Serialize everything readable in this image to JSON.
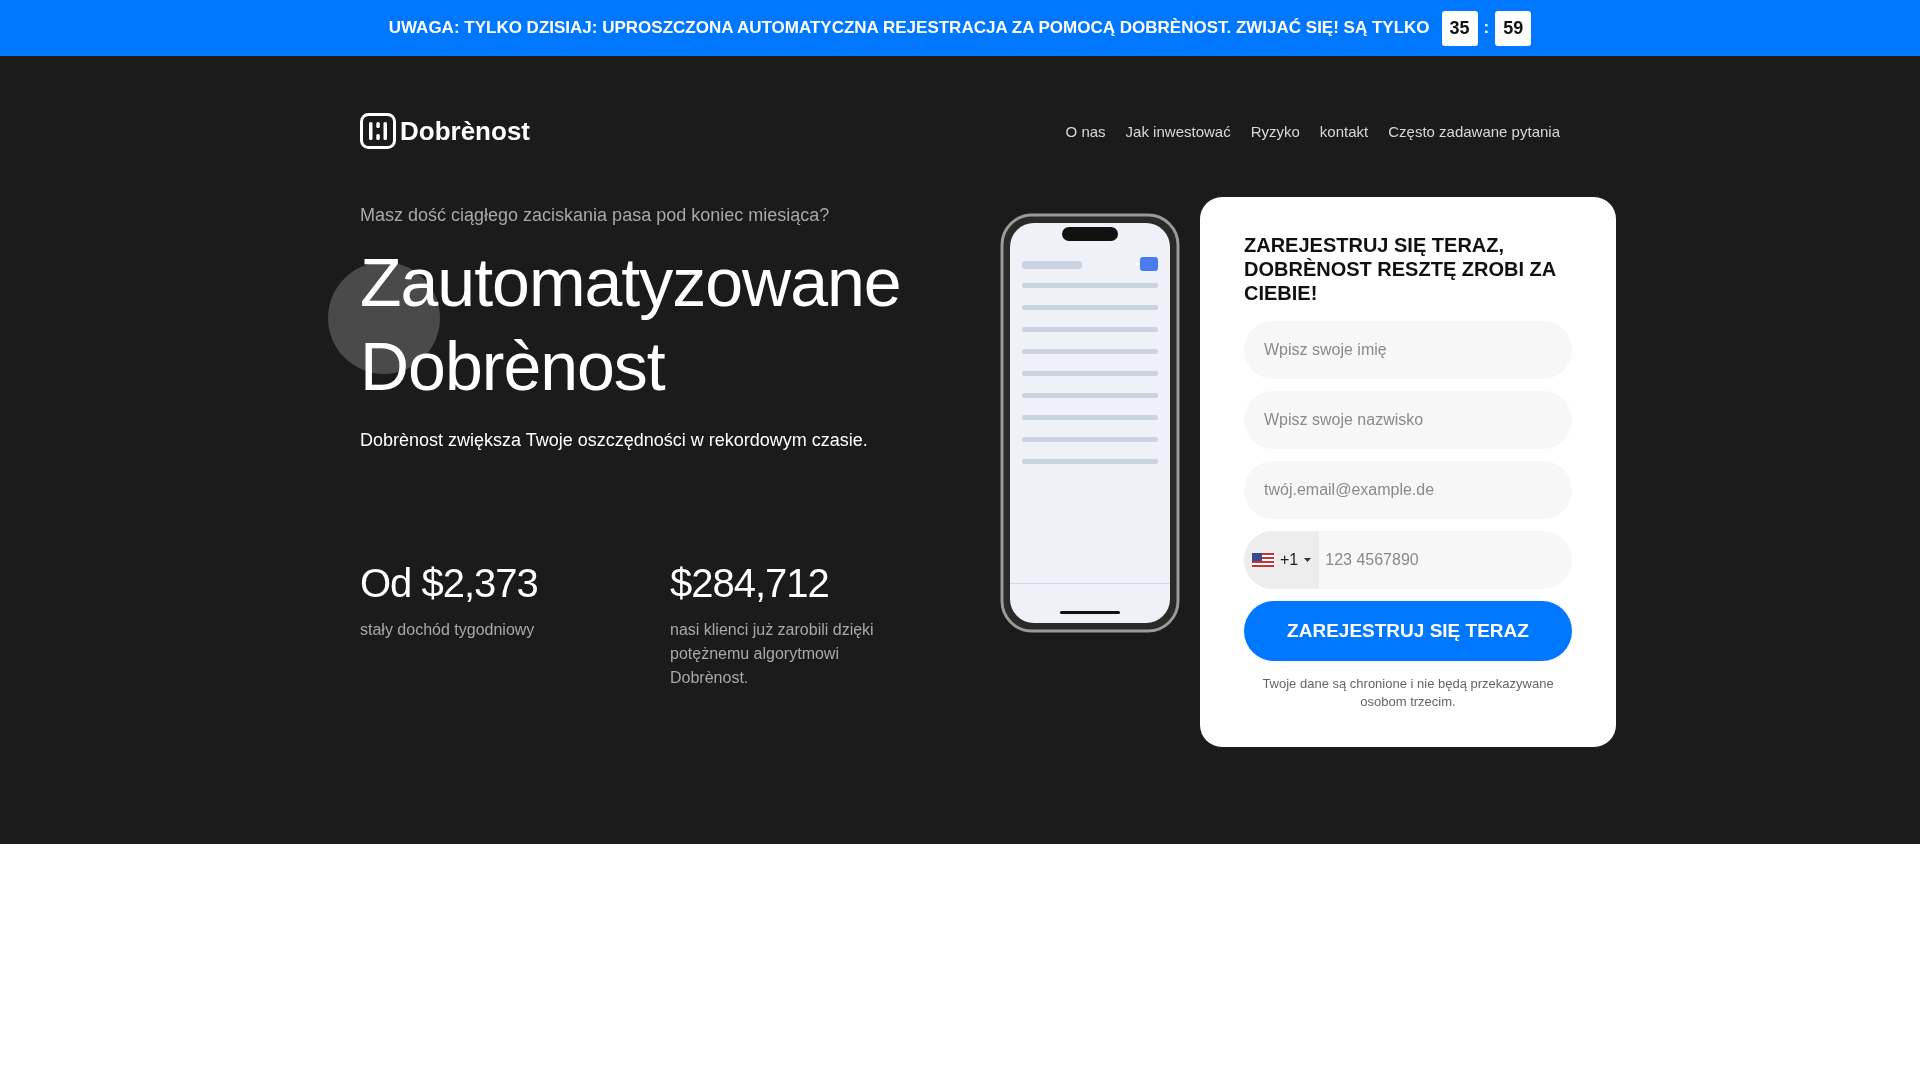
{
  "banner": {
    "text": "UWAGA: TYLKO DZISIAJ: UPROSZCZONA AUTOMATYCZNA REJESTRACJA ZA POMOCĄ DOBRÈNOST. ZWIJAĆ SIĘ! SĄ TYLKO",
    "timer": [
      "35",
      "59"
    ],
    "separator": ":"
  },
  "logo": {
    "text": "Dobrènost"
  },
  "nav": [
    "O nas",
    "Jak inwestować",
    "Ryzyko",
    "kontakt",
    "Często zadawane pytania"
  ],
  "hero": {
    "tagline": "Masz dość ciągłego zaciskania pasa pod koniec miesiąca?",
    "headline": [
      "Zautomatyzowane",
      "Dobrènost"
    ],
    "subtitle": "Dobrènost zwiększa Twoje oszczędności w rekordowym czasie."
  },
  "stats": [
    {
      "value": "Od $2,373",
      "label": "stały dochód tygodniowy"
    },
    {
      "value": "$284,712",
      "label": "nasi klienci już zarobili dzięki potężnemu algorytmowi Dobrènost."
    }
  ],
  "form": {
    "title": "ZAREJESTRUJ SIĘ TERAZ, DOBRÈNOST RESZTĘ ZROBI ZA CIEBIE!",
    "fields": [
      {
        "placeholder": "Wpisz swoje imię"
      },
      {
        "placeholder": "Wpisz swoje nazwisko"
      },
      {
        "placeholder": "twój.email@example.de"
      }
    ],
    "phone": {
      "code": "+1",
      "placeholder": "123 4567890"
    },
    "button": "ZAREJESTRUJ SIĘ TERAZ",
    "note": "Twoje dane są chronione i nie będą przekazywane osobom trzecim."
  }
}
